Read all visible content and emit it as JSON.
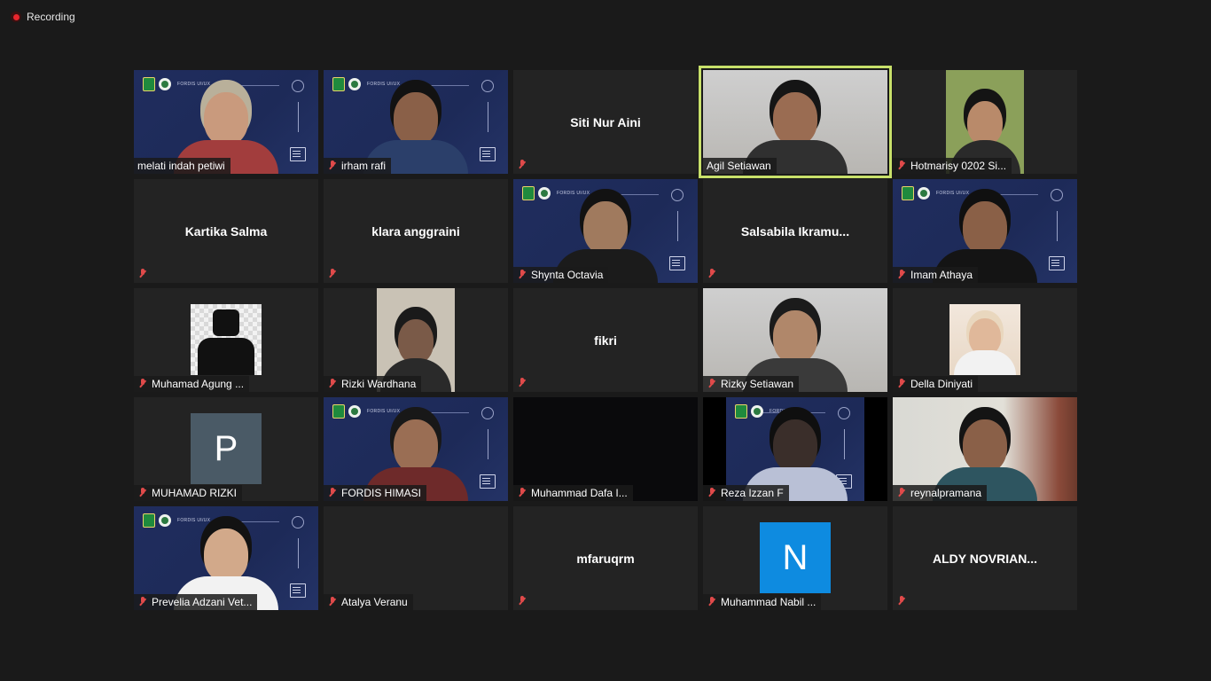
{
  "recording": {
    "label": "Recording"
  },
  "tiles": [
    {
      "name": "melati indah petiwi",
      "muted": false,
      "type": "video-fordis",
      "skin": "#c99a7d",
      "shirt": "#a23d3d",
      "hair": "#b9b09a"
    },
    {
      "name": "irham rafi",
      "muted": true,
      "type": "video-fordis",
      "skin": "#8a6048",
      "shirt": "#2b3f6a",
      "hair": "#121212"
    },
    {
      "name": "Siti Nur Aini",
      "muted": true,
      "type": "name-only"
    },
    {
      "name": "Agil Setiawan",
      "muted": false,
      "type": "video-room",
      "speaking": true,
      "skin": "#9a6c52",
      "shirt": "#303030",
      "hair": "#151515"
    },
    {
      "name": "Hotmarisy 0202 Si...",
      "muted": true,
      "type": "video-narrow",
      "skin": "#b98a6a",
      "shirt": "#2a2a2a",
      "hair": "#141414",
      "bg": "#8ba05a"
    },
    {
      "name": "Kartika Salma",
      "muted": true,
      "type": "name-only"
    },
    {
      "name": "klara anggraini",
      "muted": true,
      "type": "name-only"
    },
    {
      "name": "Shynta Octavia",
      "muted": true,
      "type": "video-fordis",
      "skin": "#a07a5e",
      "shirt": "#1b1b1b",
      "hair": "#121212"
    },
    {
      "name": "Salsabila  Ikramu...",
      "muted": true,
      "type": "name-only"
    },
    {
      "name": "Imam Athaya",
      "muted": true,
      "type": "video-fordis",
      "skin": "#8a6047",
      "shirt": "#141414",
      "hair": "#101010"
    },
    {
      "name": "Muhamad Agung ...",
      "muted": true,
      "type": "avatar-lego"
    },
    {
      "name": "Rizki Wardhana",
      "muted": true,
      "type": "video-narrow",
      "skin": "#7a5a48",
      "shirt": "#2a2a2a",
      "hair": "#1a1a1a",
      "bg": "#c9c2b5"
    },
    {
      "name": "fikri",
      "muted": true,
      "type": "name-only"
    },
    {
      "name": "Rizky Setiawan",
      "muted": true,
      "type": "video-room",
      "skin": "#b0876a",
      "shirt": "#3a3a3a",
      "hair": "#1b1b1b"
    },
    {
      "name": "Della Diniyati",
      "muted": true,
      "type": "photo",
      "skin": "#e0b89a",
      "shirt": "#f2f2f2",
      "hair": "#e9d7be"
    },
    {
      "name": "MUHAMAD RIZKI",
      "muted": true,
      "type": "avatar",
      "letter": "P",
      "avatar_color": "#4a5a66"
    },
    {
      "name": "FORDIS HIMASI",
      "muted": true,
      "type": "video-fordis",
      "skin": "#9a6e54",
      "shirt": "#6e2a2a",
      "hair": "#181818"
    },
    {
      "name": "Muhammad Dafa I...",
      "muted": true,
      "type": "video-dark"
    },
    {
      "name": "Reza Izzan F",
      "muted": true,
      "type": "video-fordis-narrow",
      "skin": "#3a2e2a",
      "shirt": "#b9c0d6",
      "hair": "#0f0f0f"
    },
    {
      "name": "reynalpramana",
      "muted": true,
      "type": "video-home",
      "skin": "#8a6048",
      "shirt": "#2e5560",
      "hair": "#141414"
    },
    {
      "name": "Prevelia Adzani Vet...",
      "muted": true,
      "type": "video-fordis",
      "skin": "#d2a98a",
      "shirt": "#f2f2f2",
      "hair": "#121212"
    },
    {
      "name": "Atalya Veranu",
      "muted": true,
      "type": "name-bottom"
    },
    {
      "name": "mfaruqrm",
      "muted": true,
      "type": "name-only"
    },
    {
      "name": "Muhammad Nabil ...",
      "muted": true,
      "type": "avatar",
      "letter": "N",
      "avatar_color": "#0e8be0"
    },
    {
      "name": "ALDY NOVRIAN...",
      "muted": true,
      "type": "name-only"
    }
  ],
  "fordis_logo_text": "FORDIS UI/UX"
}
